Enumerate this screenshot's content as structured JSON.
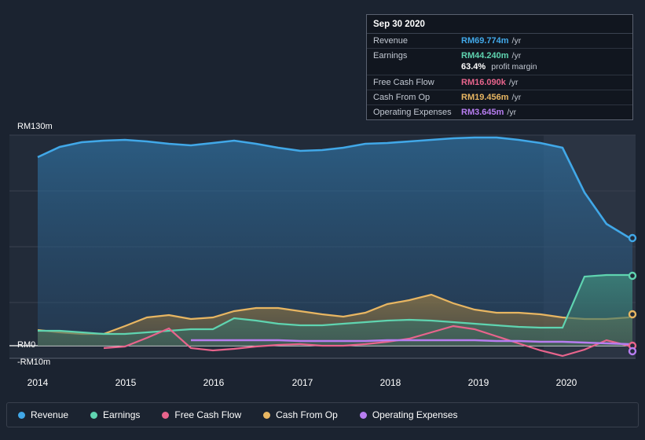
{
  "chart_data": {
    "type": "area",
    "title": "",
    "xlabel": "",
    "ylabel": "",
    "ylim": [
      -10,
      130
    ],
    "y_ticks": [
      {
        "value": 130,
        "label": "RM130m"
      },
      {
        "value": 0,
        "label": "RM0"
      },
      {
        "value": -10,
        "label": "-RM10m"
      }
    ],
    "x_ticks": [
      "2014",
      "2015",
      "2016",
      "2017",
      "2018",
      "2019",
      "2020"
    ],
    "grid": true,
    "legend_position": "bottom",
    "x": [
      2013.9,
      2014.15,
      2014.4,
      2014.65,
      2014.9,
      2015.15,
      2015.4,
      2015.65,
      2015.9,
      2016.15,
      2016.4,
      2016.65,
      2016.9,
      2017.15,
      2017.4,
      2017.65,
      2017.9,
      2018.15,
      2018.4,
      2018.65,
      2018.9,
      2019.15,
      2019.4,
      2019.65,
      2019.9,
      2020.15,
      2020.4,
      2020.65,
      2020.75
    ],
    "series": [
      {
        "name": "Revenue",
        "color": "#41a8e8",
        "values": [
          104,
          110,
          114,
          116,
          117,
          116,
          114,
          113,
          114,
          116,
          114,
          112,
          110,
          110,
          112,
          114,
          114,
          115,
          116,
          117,
          118,
          118,
          117,
          116,
          114,
          100,
          82,
          70,
          69.774
        ]
      },
      {
        "name": "Earnings",
        "color": "#5fd4b0",
        "values": [
          8,
          8,
          7,
          6,
          6,
          7,
          8,
          9,
          9,
          16,
          14,
          12,
          11,
          11,
          12,
          13,
          14,
          15,
          14,
          13,
          12,
          11,
          10,
          9,
          9,
          44,
          45,
          45,
          44.24
        ]
      },
      {
        "name": "Free Cash Flow",
        "color": "#e8648c",
        "values": [
          null,
          null,
          -3,
          -2,
          2,
          6,
          -2,
          -3,
          -2,
          -1,
          0,
          1,
          1,
          0,
          0,
          1,
          1,
          2,
          3,
          5,
          9,
          12,
          10,
          6,
          1,
          -6,
          -3,
          4,
          16.09
        ]
      },
      {
        "name": "Cash From Op",
        "color": "#e8b662",
        "values": [
          9,
          8,
          7,
          7,
          11,
          16,
          17,
          15,
          16,
          20,
          22,
          22,
          20,
          18,
          17,
          19,
          24,
          27,
          31,
          26,
          22,
          20,
          20,
          19,
          17,
          16,
          16,
          17,
          19.456
        ]
      },
      {
        "name": "Operating Expenses",
        "color": "#b77df0",
        "values": [
          null,
          null,
          null,
          null,
          null,
          null,
          null,
          4,
          4,
          4,
          4,
          4,
          4,
          4,
          4,
          4,
          4,
          4,
          4,
          4,
          4,
          4,
          4,
          4,
          4,
          4,
          4,
          4,
          3.645
        ]
      }
    ]
  },
  "tooltip": {
    "date": "Sep 30 2020",
    "rows": [
      {
        "label": "Revenue",
        "value": "RM69.774m",
        "unit": "/yr",
        "color": "#41a8e8"
      },
      {
        "label": "Earnings",
        "value": "RM44.240m",
        "unit": "/yr",
        "color": "#5fd4b0",
        "sub_value": "63.4%",
        "sub_unit": "profit margin"
      },
      {
        "label": "Free Cash Flow",
        "value": "RM16.090k",
        "unit": "/yr",
        "color": "#e8648c"
      },
      {
        "label": "Cash From Op",
        "value": "RM19.456m",
        "unit": "/yr",
        "color": "#e8b662"
      },
      {
        "label": "Operating Expenses",
        "value": "RM3.645m",
        "unit": "/yr",
        "color": "#b77df0"
      }
    ]
  },
  "legend": {
    "items": [
      {
        "label": "Revenue",
        "color": "#41a8e8"
      },
      {
        "label": "Earnings",
        "color": "#5fd4b0"
      },
      {
        "label": "Free Cash Flow",
        "color": "#e8648c"
      },
      {
        "label": "Cash From Op",
        "color": "#e8b662"
      },
      {
        "label": "Operating Expenses",
        "color": "#b77df0"
      }
    ]
  }
}
